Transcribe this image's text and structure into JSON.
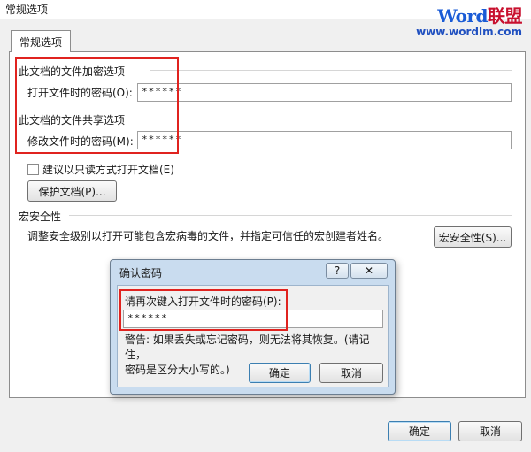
{
  "window": {
    "title": "常规选项"
  },
  "watermark": {
    "logo_word": "Word",
    "logo_cn": "联盟",
    "url": "www.wordlm.com"
  },
  "tab": {
    "label": "常规选项"
  },
  "encrypt": {
    "group_label": "此文档的文件加密选项",
    "open_label": "打开文件时的密码(O):",
    "open_value": "******"
  },
  "share": {
    "group_label": "此文档的文件共享选项",
    "modify_label": "修改文件时的密码(M):",
    "modify_value": "******",
    "readonly_label": "建议以只读方式打开文档(E)",
    "readonly_checked": false,
    "protect_button": "保护文档(P)..."
  },
  "macro": {
    "group_label": "宏安全性",
    "description": "调整安全级别以打开可能包含宏病毒的文件，并指定可信任的宏创建者姓名。",
    "button": "宏安全性(S)..."
  },
  "footer": {
    "ok": "确定",
    "cancel": "取消"
  },
  "confirm_dialog": {
    "title": "确认密码",
    "help": "?",
    "close": "✕",
    "prompt": "请再次键入打开文件时的密码(P):",
    "value": "******",
    "warning_line1": "警告: 如果丢失或忘记密码，则无法将其恢复。(请记住，",
    "warning_line2": "密码是区分大小写的。)",
    "ok": "确定",
    "cancel": "取消"
  },
  "colors": {
    "highlight": "#e0231f",
    "dialog_frame": "#c9dcef"
  }
}
